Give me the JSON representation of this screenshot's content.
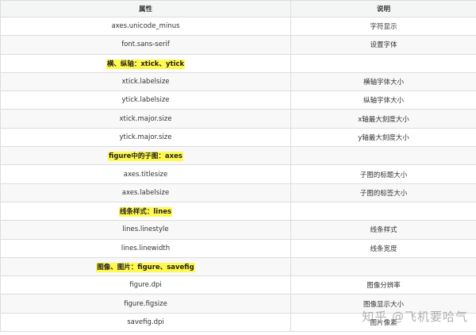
{
  "headers": {
    "property": "属性",
    "description": "说明"
  },
  "rows": [
    {
      "property": "axes.unicode_minus",
      "description": "字符显示",
      "highlight": false
    },
    {
      "property": "font.sans-serif",
      "description": "设置字体",
      "highlight": false
    },
    {
      "property": "横、纵轴：xtick、ytick",
      "description": "",
      "highlight": true
    },
    {
      "property": "xtick.labelsize",
      "description": "横轴字体大小",
      "highlight": false
    },
    {
      "property": "ytick.labelsize",
      "description": "纵轴字体大小",
      "highlight": false
    },
    {
      "property": "xtick.major.size",
      "description": "x轴最大刻度大小",
      "highlight": false
    },
    {
      "property": "ytick.major.size",
      "description": "y轴最大刻度大小",
      "highlight": false
    },
    {
      "property": "figure中的子图：axes",
      "description": "",
      "highlight": true
    },
    {
      "property": "axes.titlesize",
      "description": "子图的标题大小",
      "highlight": false
    },
    {
      "property": "axes.labelsize",
      "description": "子图的标签大小",
      "highlight": false
    },
    {
      "property": "线条样式：lines",
      "description": "",
      "highlight": true
    },
    {
      "property": "lines.linestyle",
      "description": "线条样式",
      "highlight": false
    },
    {
      "property": "lines.linewidth",
      "description": "线条宽度",
      "highlight": false
    },
    {
      "property": "图像、图片：figure、savefig",
      "description": "",
      "highlight": true
    },
    {
      "property": "figure.dpi",
      "description": "图像分辨率",
      "highlight": false
    },
    {
      "property": "figure.figsize",
      "description": "图像显示大小",
      "highlight": false
    },
    {
      "property": "savefig.dpi",
      "description": "图片像素",
      "highlight": false
    }
  ],
  "watermark": "知乎 @飞机要哈气",
  "colors": {
    "highlight": "#fff94f",
    "header_bg": "#f4f6f6",
    "border": "#dddddd"
  }
}
